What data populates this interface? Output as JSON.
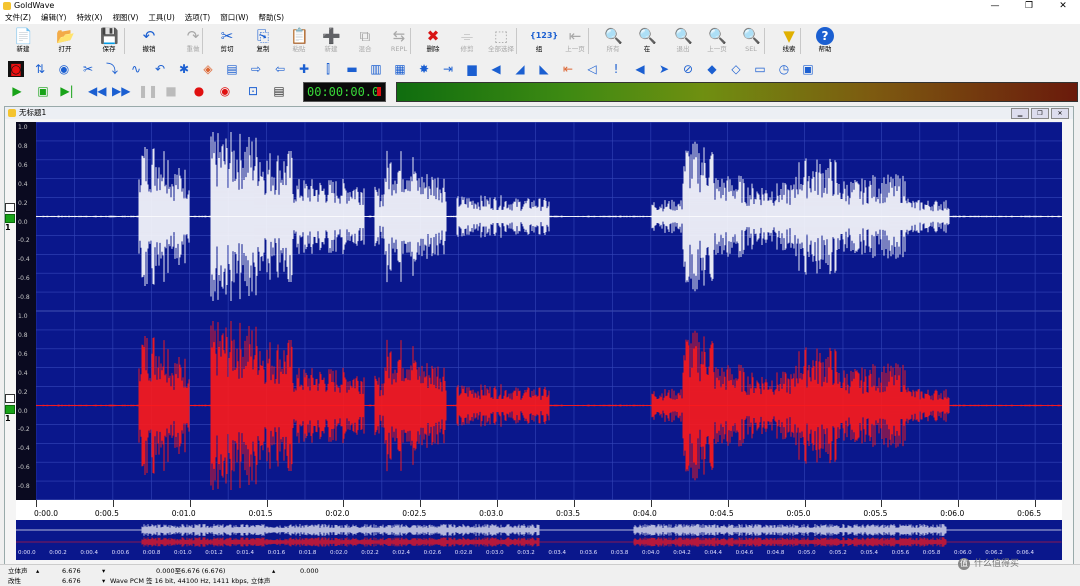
{
  "window": {
    "title": "GoldWave",
    "buttons": [
      "—",
      "❐",
      "✕"
    ]
  },
  "menu": [
    "文件(Z)",
    "编辑(Y)",
    "特效(X)",
    "视图(V)",
    "工具(U)",
    "选项(T)",
    "窗口(W)",
    "帮助(S)"
  ],
  "toolbar": [
    {
      "label": "新建",
      "icon": "📄",
      "enabled": true
    },
    {
      "label": "打开",
      "icon": "📂",
      "enabled": true
    },
    {
      "label": "保存",
      "icon": "💾",
      "enabled": true
    },
    {
      "label": "撤销",
      "icon": "↶",
      "enabled": true
    },
    {
      "label": "重做",
      "icon": "↷",
      "enabled": false
    },
    {
      "label": "剪切",
      "icon": "✂",
      "enabled": true
    },
    {
      "label": "复制",
      "icon": "⎘",
      "enabled": true
    },
    {
      "label": "粘贴",
      "icon": "📋",
      "enabled": false
    },
    {
      "label": "新建",
      "icon": "➕",
      "enabled": false
    },
    {
      "label": "混合",
      "icon": "⧉",
      "enabled": false
    },
    {
      "label": "REPL",
      "icon": "⇆",
      "enabled": false
    },
    {
      "label": "删除",
      "icon": "✖",
      "enabled": true
    },
    {
      "label": "修剪",
      "icon": "⌯",
      "enabled": false
    },
    {
      "label": "全部选择",
      "icon": "⬚",
      "enabled": false
    },
    {
      "label": "组",
      "icon": "{123}",
      "enabled": true
    },
    {
      "label": "上一页",
      "icon": "⇤",
      "enabled": false
    },
    {
      "label": "所有",
      "icon": "🔍",
      "enabled": false
    },
    {
      "label": "在",
      "icon": "🔍",
      "enabled": true
    },
    {
      "label": "退出",
      "icon": "🔍",
      "enabled": false
    },
    {
      "label": "上一页",
      "icon": "🔍",
      "enabled": false
    },
    {
      "label": "SEL",
      "icon": "🔍",
      "enabled": false
    },
    {
      "label": "线索",
      "icon": "▼",
      "enabled": true
    },
    {
      "label": "帮助",
      "icon": "?",
      "enabled": true
    }
  ],
  "timer": "00:00:00.0",
  "document": {
    "title": "无标题1"
  },
  "channels": [
    {
      "number": "1",
      "color": "#ffffff"
    },
    {
      "number": "1",
      "color": "#ff1a1a"
    }
  ],
  "y_labels": [
    "1.0",
    "0.8",
    "0.6",
    "0.4",
    "0.2",
    "0.0",
    "-0.2",
    "-0.4",
    "-0.6",
    "-0.8"
  ],
  "timeline_labels": [
    "0:00.0",
    "0:00.5",
    "0:01.0",
    "0:01.5",
    "0:02.0",
    "0:02.5",
    "0:03.0",
    "0:03.5",
    "0:04.0",
    "0:04.5",
    "0:05.0",
    "0:05.5",
    "0:06.0",
    "0:06.5"
  ],
  "overview_labels": [
    "0:00.0",
    "0:00.2",
    "0:00.4",
    "0:00.6",
    "0:00.8",
    "0:01.0",
    "0:01.2",
    "0:01.4",
    "0:01.6",
    "0:01.8",
    "0:02.0",
    "0:02.2",
    "0:02.4",
    "0:02.6",
    "0:02.8",
    "0:03.0",
    "0:03.2",
    "0:03.4",
    "0:03.6",
    "0:03.8",
    "0:04.0",
    "0:04.2",
    "0:04.4",
    "0:04.6",
    "0:04.8",
    "0:05.0",
    "0:05.2",
    "0:05.4",
    "0:05.6",
    "0:05.8",
    "0:06.0",
    "0:06.2",
    "0:06.4"
  ],
  "status": {
    "row1": {
      "channel": "立体声",
      "duration": "6.676",
      "selection": "0.000至6.676 (6.676)",
      "position": "0.000"
    },
    "row2": {
      "label": "改性",
      "duration": "6.676",
      "format": "Wave PCM 签 16 bit, 44100 Hz, 1411 kbps, 立体声"
    }
  },
  "watermark": "什么值得买",
  "colors": {
    "wave_bg": "#0a178c",
    "channel1": "#ffffff",
    "channel2": "#ff1a1a"
  }
}
